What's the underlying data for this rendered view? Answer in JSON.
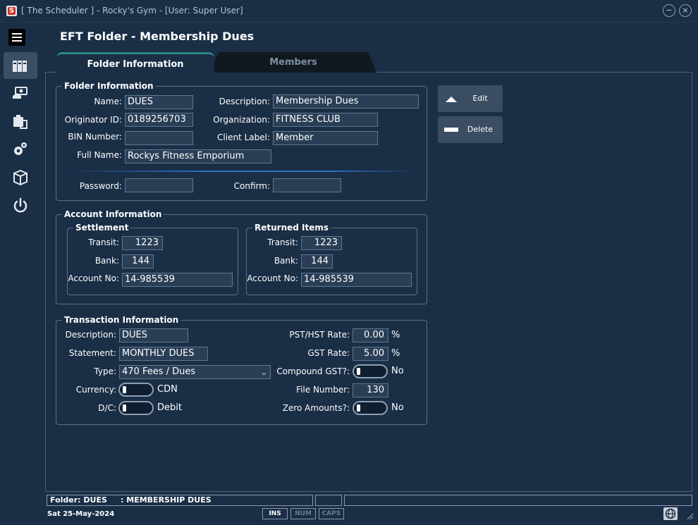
{
  "window": {
    "title": "[ The Scheduler ] - Rocky's Gym - [User: Super User]",
    "minimize_icon": "−",
    "close_icon": "×"
  },
  "page": {
    "title": "EFT Folder - Membership Dues"
  },
  "sidebar": {
    "items": [
      "menu-icon",
      "folders-icon",
      "payment-icon",
      "clipboard-icon",
      "settings-icon",
      "package-icon",
      "power-icon"
    ],
    "active": "folders-icon"
  },
  "tabs": [
    {
      "label": "Folder Information",
      "active": true
    },
    {
      "label": "Members",
      "active": false
    }
  ],
  "folder_info": {
    "title": "Folder Information",
    "name_label": "Name:",
    "name": "DUES",
    "description_label": "Description:",
    "description": "Membership Dues",
    "originator_label": "Originator ID:",
    "originator": "0189256703",
    "organization_label": "Organization:",
    "organization": "FITNESS CLUB",
    "bin_label": "BIN Number:",
    "bin": "",
    "client_label_label": "Client Label:",
    "client_label": "Member",
    "full_name_label": "Full Name:",
    "full_name": "Rockys Fitness Emporium",
    "password_label": "Password:",
    "password": "",
    "confirm_label": "Confirm:",
    "confirm": ""
  },
  "account_info": {
    "title": "Account Information",
    "settlement": {
      "title": "Settlement",
      "transit_label": "Transit:",
      "transit": "1223",
      "bank_label": "Bank:",
      "bank": "144",
      "account_label": "Account No:",
      "account": "14-985539"
    },
    "returned": {
      "title": "Returned Items",
      "transit_label": "Transit:",
      "transit": "1223",
      "bank_label": "Bank:",
      "bank": "144",
      "account_label": "Account No:",
      "account": "14-985539"
    }
  },
  "transaction_info": {
    "title": "Transaction Information",
    "description_label": "Description:",
    "description": "DUES",
    "statement_label": "Statement:",
    "statement": "MONTHLY DUES",
    "type_label": "Type:",
    "type": "470  Fees / Dues",
    "type_arrow": "⌄",
    "currency_label": "Currency:",
    "currency": "CDN",
    "dc_label": "D/C:",
    "dc": "Debit",
    "pst_label": "PST/HST Rate:",
    "pst": "0.00",
    "pst_unit": "%",
    "gst_label": "GST Rate:",
    "gst": "5.00",
    "gst_unit": "%",
    "compound_label": "Compound GST?:",
    "compound": "No",
    "file_number_label": "File Number:",
    "file_number": "130",
    "zero_label": "Zero Amounts?:",
    "zero": "No"
  },
  "actions": {
    "edit": "Edit",
    "delete": "Delete"
  },
  "status": {
    "folder": "Folder: DUES     : MEMBERSHIP DUES",
    "date": "Sat  25-May-2024",
    "ins": "INS",
    "num": "NUM",
    "caps": "CAPS"
  },
  "colors": {
    "background": "#1a2e46",
    "field": "#2a3e56",
    "accent": "#2a8a88"
  }
}
